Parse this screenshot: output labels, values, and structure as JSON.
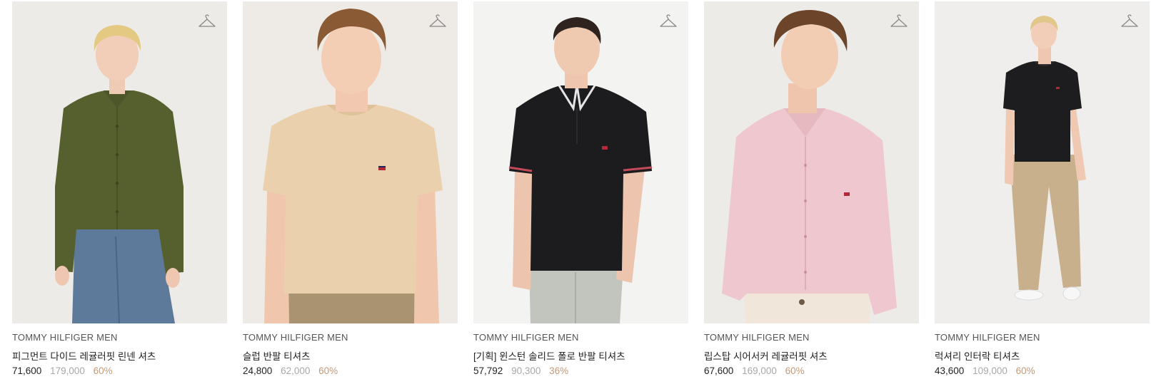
{
  "products": [
    {
      "brand": "TOMMY HILFIGER MEN",
      "name": "피그먼트 다이드 레귤러핏 린넨 셔츠",
      "price": "71,600",
      "original_price": "179,000",
      "discount": "60%"
    },
    {
      "brand": "TOMMY HILFIGER MEN",
      "name": "슬럽 반팔 티셔츠",
      "price": "24,800",
      "original_price": "62,000",
      "discount": "60%"
    },
    {
      "brand": "TOMMY HILFIGER MEN",
      "name": "[기획] 윈스턴 솔리드 폴로 반팔 티셔츠",
      "price": "57,792",
      "original_price": "90,300",
      "discount": "36%"
    },
    {
      "brand": "TOMMY HILFIGER MEN",
      "name": "립스탑 시어서커 레귤러핏 셔츠",
      "price": "67,600",
      "original_price": "169,000",
      "discount": "60%"
    },
    {
      "brand": "TOMMY HILFIGER MEN",
      "name": "럭셔리 인터락 티셔츠",
      "price": "43,600",
      "original_price": "109,000",
      "discount": "60%"
    }
  ],
  "icons": {
    "wishlist": "hanger-icon"
  },
  "colors": {
    "discount": "#c39a78",
    "original_price": "#a8a8a8",
    "text": "#222222"
  }
}
